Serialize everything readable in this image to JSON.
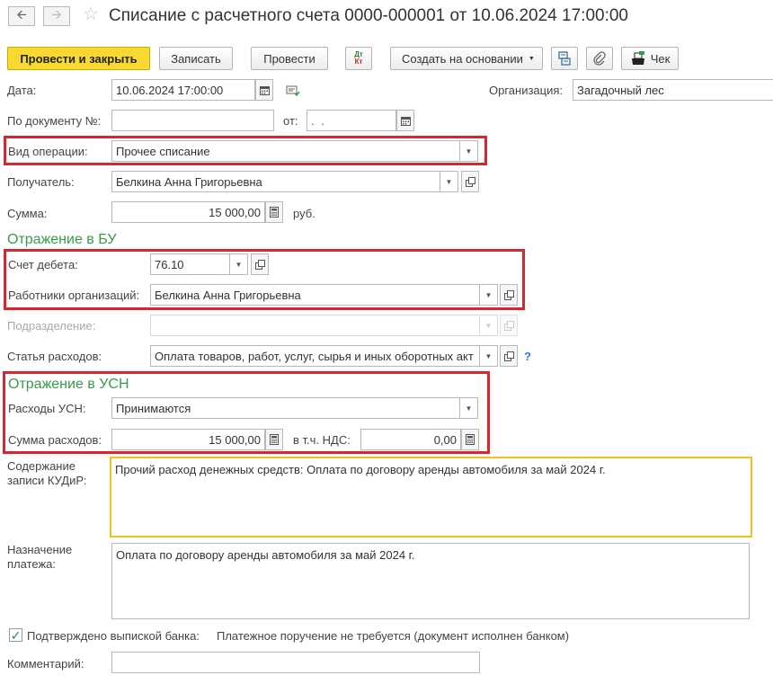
{
  "header": {
    "title": "Списание с расчетного счета 0000-000001 от 10.06.2024 17:00:00",
    "back_icon": "arrow-left-icon",
    "forward_icon": "arrow-right-icon",
    "favorite_icon": "star-icon"
  },
  "toolbar": {
    "post_and_close": "Провести и закрыть",
    "save": "Записать",
    "post": "Провести",
    "dt_kt_icon_top": "Дт",
    "dt_kt_icon_bottom": "Кт",
    "create_based_on": "Создать на основании",
    "receipt": "Чек"
  },
  "form": {
    "date_label": "Дата:",
    "date_value": "10.06.2024 17:00:00",
    "organization_label": "Организация:",
    "organization_value": "Загадочный лес",
    "doc_number_label": "По документу №:",
    "doc_number_value": "",
    "from_label": "от:",
    "from_value": ". .",
    "operation_label": "Вид операции:",
    "operation_value": "Прочее списание",
    "recipient_label": "Получатель:",
    "recipient_value": "Белкина Анна  Григорьевна",
    "amount_label": "Сумма:",
    "amount_value": "15 000,00",
    "currency": "руб."
  },
  "bu": {
    "section_title": "Отражение в БУ",
    "debit_label": "Счет дебета:",
    "debit_value": "76.10",
    "employees_label": "Работники организаций:",
    "employees_value": "Белкина Анна Григорьевна",
    "department_label": "Подразделение:",
    "department_value": "",
    "expense_item_label": "Статья расходов:",
    "expense_item_value": "Оплата товаров, работ, услуг, сырья и иных оборотных акт",
    "help": "?"
  },
  "usn": {
    "section_title": "Отражение в УСН",
    "expenses_label": "Расходы УСН:",
    "expenses_value": "Принимаются",
    "expenses_sum_label": "Сумма расходов:",
    "expenses_sum_value": "15 000,00",
    "vat_label": "в т.ч. НДС:",
    "vat_value": "0,00"
  },
  "kudir": {
    "label_line1": "Содержание",
    "label_line2": "записи КУДиР:",
    "value": "Прочий расход денежных средств: Оплата по договору аренды автомобиля за май 2024 г."
  },
  "payment": {
    "label_line1": "Назначение",
    "label_line2": "платежа:",
    "value": "Оплата по договору аренды автомобиля за май 2024 г."
  },
  "bank": {
    "confirmed_label": "Подтверждено выпиской банка:",
    "confirmed_checked": true,
    "order_note": "Платежное поручение не требуется (документ исполнен банком)"
  },
  "comment": {
    "label": "Комментарий:",
    "value": ""
  },
  "colors": {
    "primary_button": "#f7d932",
    "section_green": "#3a9a4a",
    "highlight_red": "#d6262e",
    "active_field": "#f0c020"
  }
}
